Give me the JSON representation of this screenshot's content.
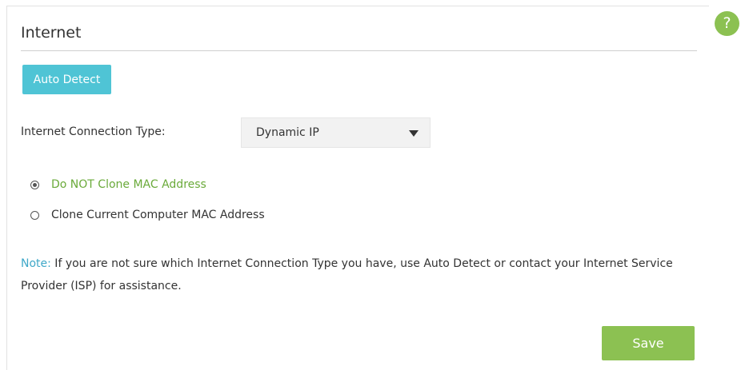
{
  "help": {
    "glyph": "?"
  },
  "section": {
    "title": "Internet"
  },
  "auto_detect": {
    "label": "Auto Detect"
  },
  "connection": {
    "label": "Internet Connection Type:",
    "selected": "Dynamic IP"
  },
  "mac_options": [
    {
      "label": "Do NOT Clone MAC Address",
      "checked": true
    },
    {
      "label": "Clone Current Computer MAC Address",
      "checked": false
    }
  ],
  "note": {
    "prefix": "Note:",
    "text": " If you are not sure which Internet Connection Type you have, use Auto Detect or contact your Internet Service Provider (ISP) for assistance."
  },
  "save": {
    "label": "Save"
  },
  "colors": {
    "accent_green": "#8cc152",
    "accent_blue": "#4fc4d5",
    "note_blue": "#3fa8c8",
    "active_text": "#6aaa3a"
  }
}
